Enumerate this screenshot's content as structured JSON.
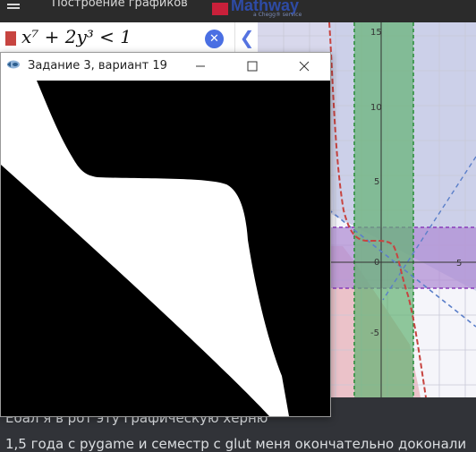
{
  "desmos": {
    "title": "Построение графиков",
    "brand": "Mathway",
    "brand_sub": "a Chegg® service",
    "expression": "x⁷ + 2y³ < 1",
    "clear_icon": "close-circle-icon",
    "collapse_icon": "chevron-left-icon",
    "y_ticks": [
      "15",
      "10",
      "5",
      "0",
      "-5"
    ],
    "x_tick": "5",
    "colors": {
      "red": "#c74440",
      "blue": "#2d70b3",
      "green": "#388c46",
      "purple": "#6042a6",
      "pink": "#e86ab2"
    }
  },
  "window": {
    "title": "Задание 3, вариант 19",
    "icon": "app-icon",
    "minimize_icon": "minimize-icon",
    "maximize_icon": "maximize-icon",
    "close_icon": "close-icon"
  },
  "chat": {
    "line1": "Ебал я в рот эту графическую херню",
    "line2": "1,5 года с pygame и семестр с glut меня окончательно доконали"
  }
}
